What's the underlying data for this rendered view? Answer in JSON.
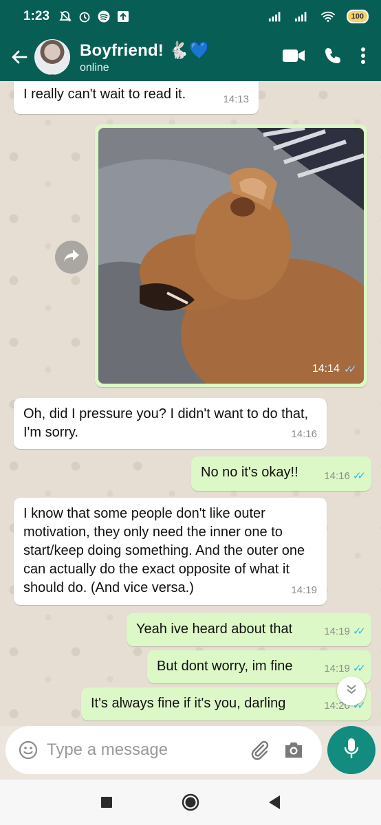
{
  "status_bar": {
    "time": "1:23",
    "battery": "100",
    "icons": [
      "do-not-disturb-icon",
      "alarm-icon",
      "spotify-icon",
      "upload-icon",
      "signal-icon",
      "wifi-icon",
      "battery-icon"
    ]
  },
  "header": {
    "contact_name": "Boyfriend! 🐇💙",
    "status": "online"
  },
  "messages": [
    {
      "dir": "in",
      "text": "I really can't wait to read it.",
      "time": "14:13"
    },
    {
      "dir": "out",
      "type": "image",
      "time": "14:14",
      "ticks": "✓✓"
    },
    {
      "dir": "in",
      "text": "Oh, did I pressure you? I didn't want to do that, I'm sorry.",
      "time": "14:16"
    },
    {
      "dir": "out",
      "text": "No no it's okay!!",
      "time": "14:16",
      "ticks": "✓✓"
    },
    {
      "dir": "in",
      "text": "I know that some people don't like outer motivation, they only need the inner one to start/keep doing something. And the outer one can actually do the exact opposite of what it should do. (And vice versa.)",
      "time": "14:19"
    },
    {
      "dir": "out",
      "text": "Yeah ive heard about that",
      "time": "14:19",
      "ticks": "✓✓"
    },
    {
      "dir": "out",
      "text": "But dont worry, im fine",
      "time": "14:19",
      "ticks": "✓✓"
    },
    {
      "dir": "out",
      "text": "It's always fine if it's you, darling",
      "time": "14:20",
      "ticks": "✓✓"
    }
  ],
  "input": {
    "placeholder": "Type a message"
  },
  "colors": {
    "header": "#075e54",
    "outgoing_bubble": "#dcf8c6",
    "incoming_bubble": "#ffffff",
    "mic_button": "#128c7e",
    "read_ticks": "#34b7f1"
  }
}
